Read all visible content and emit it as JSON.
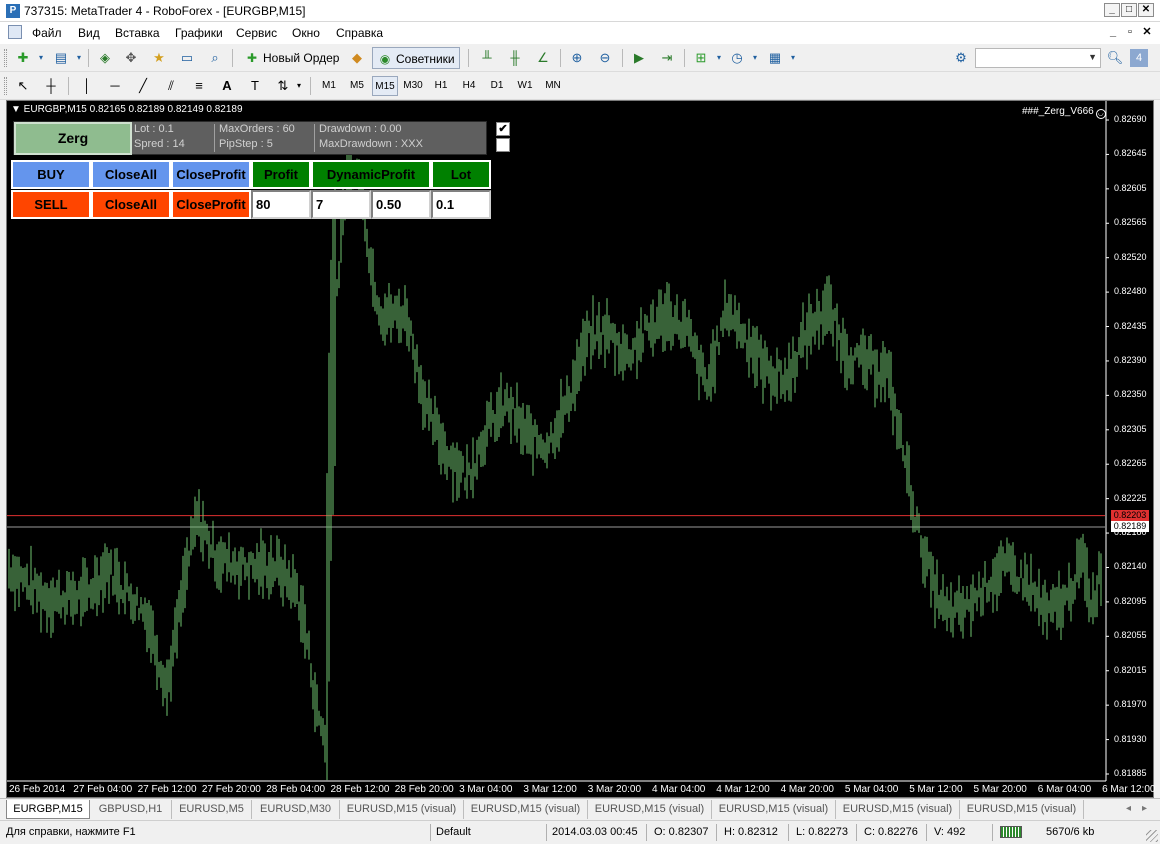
{
  "window": {
    "title": "737315: MetaTrader 4 - RoboForex - [EURGBP,M15]",
    "app_icon": "metatrader-icon",
    "controls": [
      "_",
      "□",
      "X"
    ],
    "mdi_controls": [
      "_",
      "▫",
      "X"
    ]
  },
  "menu": {
    "items": [
      "Файл",
      "Вид",
      "Вставка",
      "Графики",
      "Сервис",
      "Окно",
      "Справка"
    ]
  },
  "toolbar": {
    "new_order": "Новый Ордер",
    "experts": "Советники",
    "search_placeholder": ""
  },
  "timeframes": [
    "M1",
    "M5",
    "M15",
    "M30",
    "H1",
    "H4",
    "D1",
    "W1",
    "MN"
  ],
  "active_timeframe": "M15",
  "chart": {
    "header": "▼ EURGBP,M15  0.82165 0.82189 0.82149 0.82189",
    "ea_label": "###_Zerg_V666",
    "price_labels": [
      "0.82690",
      "0.82645",
      "0.82605",
      "0.82565",
      "0.82520",
      "0.82480",
      "0.82435",
      "0.82390",
      "0.82350",
      "0.82305",
      "0.82265",
      "0.82225",
      "0.82180",
      "0.82140",
      "0.82095",
      "0.82055",
      "0.82015",
      "0.81970",
      "0.81930",
      "0.81885"
    ],
    "time_labels": [
      "26 Feb 2014",
      "27 Feb 04:00",
      "27 Feb 12:00",
      "27 Feb 20:00",
      "28 Feb 04:00",
      "28 Feb 12:00",
      "28 Feb 20:00",
      "3 Mar 04:00",
      "3 Mar 12:00",
      "3 Mar 20:00",
      "4 Mar 04:00",
      "4 Mar 12:00",
      "4 Mar 20:00",
      "5 Mar 04:00",
      "5 Mar 12:00",
      "5 Mar 20:00",
      "6 Mar 04:00",
      "6 Mar 12:00"
    ],
    "ask_price": "0.82203",
    "bid_price": "0.82189",
    "colors": {
      "background": "#000000",
      "bars": "#6fc46f",
      "ask_line": "#e03030",
      "bid_line": "#9a9a9a"
    }
  },
  "panel": {
    "zerg_label": "Zerg",
    "info": {
      "lot": "Lot       : 0.1",
      "spred": "Spred    : 14",
      "max_orders": "MaxOrders : 60",
      "pip_step": "PipStep      : 5",
      "drawdown": "Drawdown            : 0.00",
      "max_drawdown": "MaxDrawdown       : XXX"
    },
    "checkbox_1": "✔",
    "checkbox_2": "",
    "buy": "BUY",
    "sell": "SELL",
    "close_all": "CloseAll",
    "close_profit": "CloseProfit",
    "profit_label": "Profit",
    "dynamic_profit_label": "DynamicProfit",
    "lot_label": "Lot",
    "profit_value": "80",
    "dynamic_profit_value": "7",
    "ratio_value": "0.50",
    "lot_value": "0.1"
  },
  "tabs": [
    "EURGBP,M15",
    "GBPUSD,H1",
    "EURUSD,M5",
    "EURUSD,M30",
    "EURUSD,M15 (visual)",
    "EURUSD,M15 (visual)",
    "EURUSD,M15 (visual)",
    "EURUSD,M15 (visual)",
    "EURUSD,M15 (visual)",
    "EURUSD,M15 (visual)"
  ],
  "status": {
    "help": "Для справки, нажмите F1",
    "profile": "Default",
    "datetime": "2014.03.03 00:45",
    "open": "O: 0.82307",
    "high": "H: 0.82312",
    "low": "L: 0.82273",
    "close": "C: 0.82276",
    "volume": "V: 492",
    "traffic": "5670/6 kb"
  }
}
